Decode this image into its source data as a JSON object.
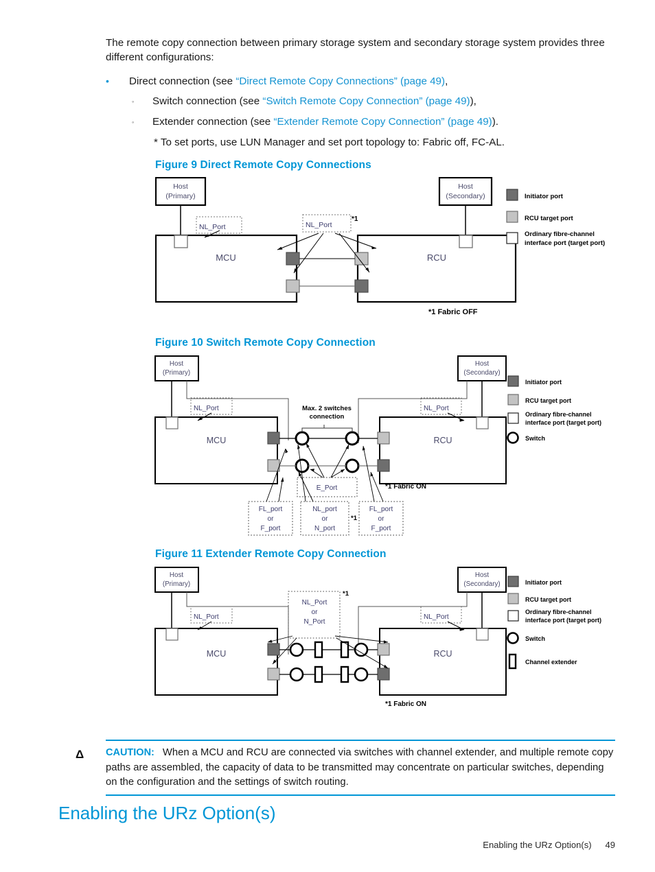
{
  "intro": {
    "paragraph": "The remote copy connection between primary storage system and secondary storage system provides three different configurations:"
  },
  "bullets": [
    {
      "level": 1,
      "marker": "•",
      "pre": "Direct connection (see ",
      "link": "“Direct Remote Copy Connections” (page 49)",
      "post": ","
    },
    {
      "level": 2,
      "marker": "◦",
      "pre": "Switch connection (see ",
      "link": "“Switch Remote Copy Connection” (page 49)",
      "post": "),"
    },
    {
      "level": 2,
      "marker": "◦",
      "pre": "Extender connection (see ",
      "link": "“Extender Remote Copy Connection” (page 49)",
      "post": ")."
    }
  ],
  "note": "* To set ports, use LUN Manager and set port topology to: Fabric off, FC-AL.",
  "figures": [
    {
      "caption": "Figure 9 Direct Remote Copy Connections",
      "host_primary": [
        "Host",
        "(Primary)"
      ],
      "host_secondary": [
        "Host",
        "(Secondary)"
      ],
      "mcu_label": "MCU",
      "rcu_label": "RCU",
      "callout_left": "NL_Port",
      "callout_mid": "NL_Port",
      "callout_mid_sup": "*1",
      "fabric_note": "*1 Fabric OFF",
      "legend": [
        {
          "swatch": "initiator",
          "label": "Initiator port"
        },
        {
          "swatch": "rcu-target",
          "label": "RCU target port"
        },
        {
          "swatch": "ordinary",
          "label": "Ordinary fibre-channel",
          "label2": "interface port (target port)"
        }
      ]
    },
    {
      "caption": "Figure 10 Switch Remote Copy Connection",
      "host_primary": [
        "Host",
        "(Primary)"
      ],
      "host_secondary": [
        "Host",
        "(Secondary)"
      ],
      "mcu_label": "MCU",
      "rcu_label": "RCU",
      "callout_left": "NL_Port",
      "callout_right": "NL_Port",
      "switch_note": [
        "Max. 2 switches",
        "connection"
      ],
      "e_port": "E_Port",
      "fl_left": [
        "FL_port",
        "or",
        "F_port"
      ],
      "nl_mid": [
        "NL_port",
        "or",
        "N_port"
      ],
      "nl_mid_sup": "*1",
      "fl_right": [
        "FL_port",
        "or",
        "F_port"
      ],
      "fabric_note": "*1 Fabric ON",
      "legend": [
        {
          "swatch": "initiator",
          "label": "Initiator port"
        },
        {
          "swatch": "rcu-target",
          "label": "RCU target port"
        },
        {
          "swatch": "ordinary",
          "label": "Ordinary fibre-channel",
          "label2": "interface port (target port)"
        },
        {
          "swatch": "switch",
          "label": "Switch"
        }
      ]
    },
    {
      "caption": "Figure 11 Extender Remote Copy Connection",
      "host_primary": [
        "Host",
        "(Primary)"
      ],
      "host_secondary": [
        "Host",
        "(Secondary)"
      ],
      "mcu_label": "MCU",
      "rcu_label": "RCU",
      "callout_left": "NL_Port",
      "callout_right": "NL_Port",
      "callout_mid": [
        "NL_Port",
        "or",
        "N_Port"
      ],
      "callout_mid_sup": "*1",
      "fabric_note": "*1 Fabric ON",
      "legend": [
        {
          "swatch": "initiator",
          "label": "Initiator port"
        },
        {
          "swatch": "rcu-target",
          "label": "RCU target port"
        },
        {
          "swatch": "ordinary",
          "label": "Ordinary fibre-channel",
          "label2": "interface port (target port)"
        },
        {
          "swatch": "switch",
          "label": "Switch"
        },
        {
          "swatch": "extender",
          "label": "Channel extender"
        }
      ]
    }
  ],
  "caution": {
    "icon": "warning-triangle",
    "label": "CAUTION:",
    "text": "When a MCU and RCU are connected via switches with channel extender, and multiple remote copy paths are assembled, the capacity of data to be transmitted may concentrate on particular switches, depending on the configuration and the settings of switch routing."
  },
  "section_title": "Enabling the URz Option(s)",
  "footer": {
    "title": "Enabling the URz Option(s)",
    "page": "49"
  },
  "colors": {
    "accent_blue": "#0096d6",
    "link_blue": "#1694d2",
    "initiator_gray": "#6e6e6e",
    "rcu_target_gray": "#bfbfbf",
    "box_text": "#4a4a6a"
  }
}
